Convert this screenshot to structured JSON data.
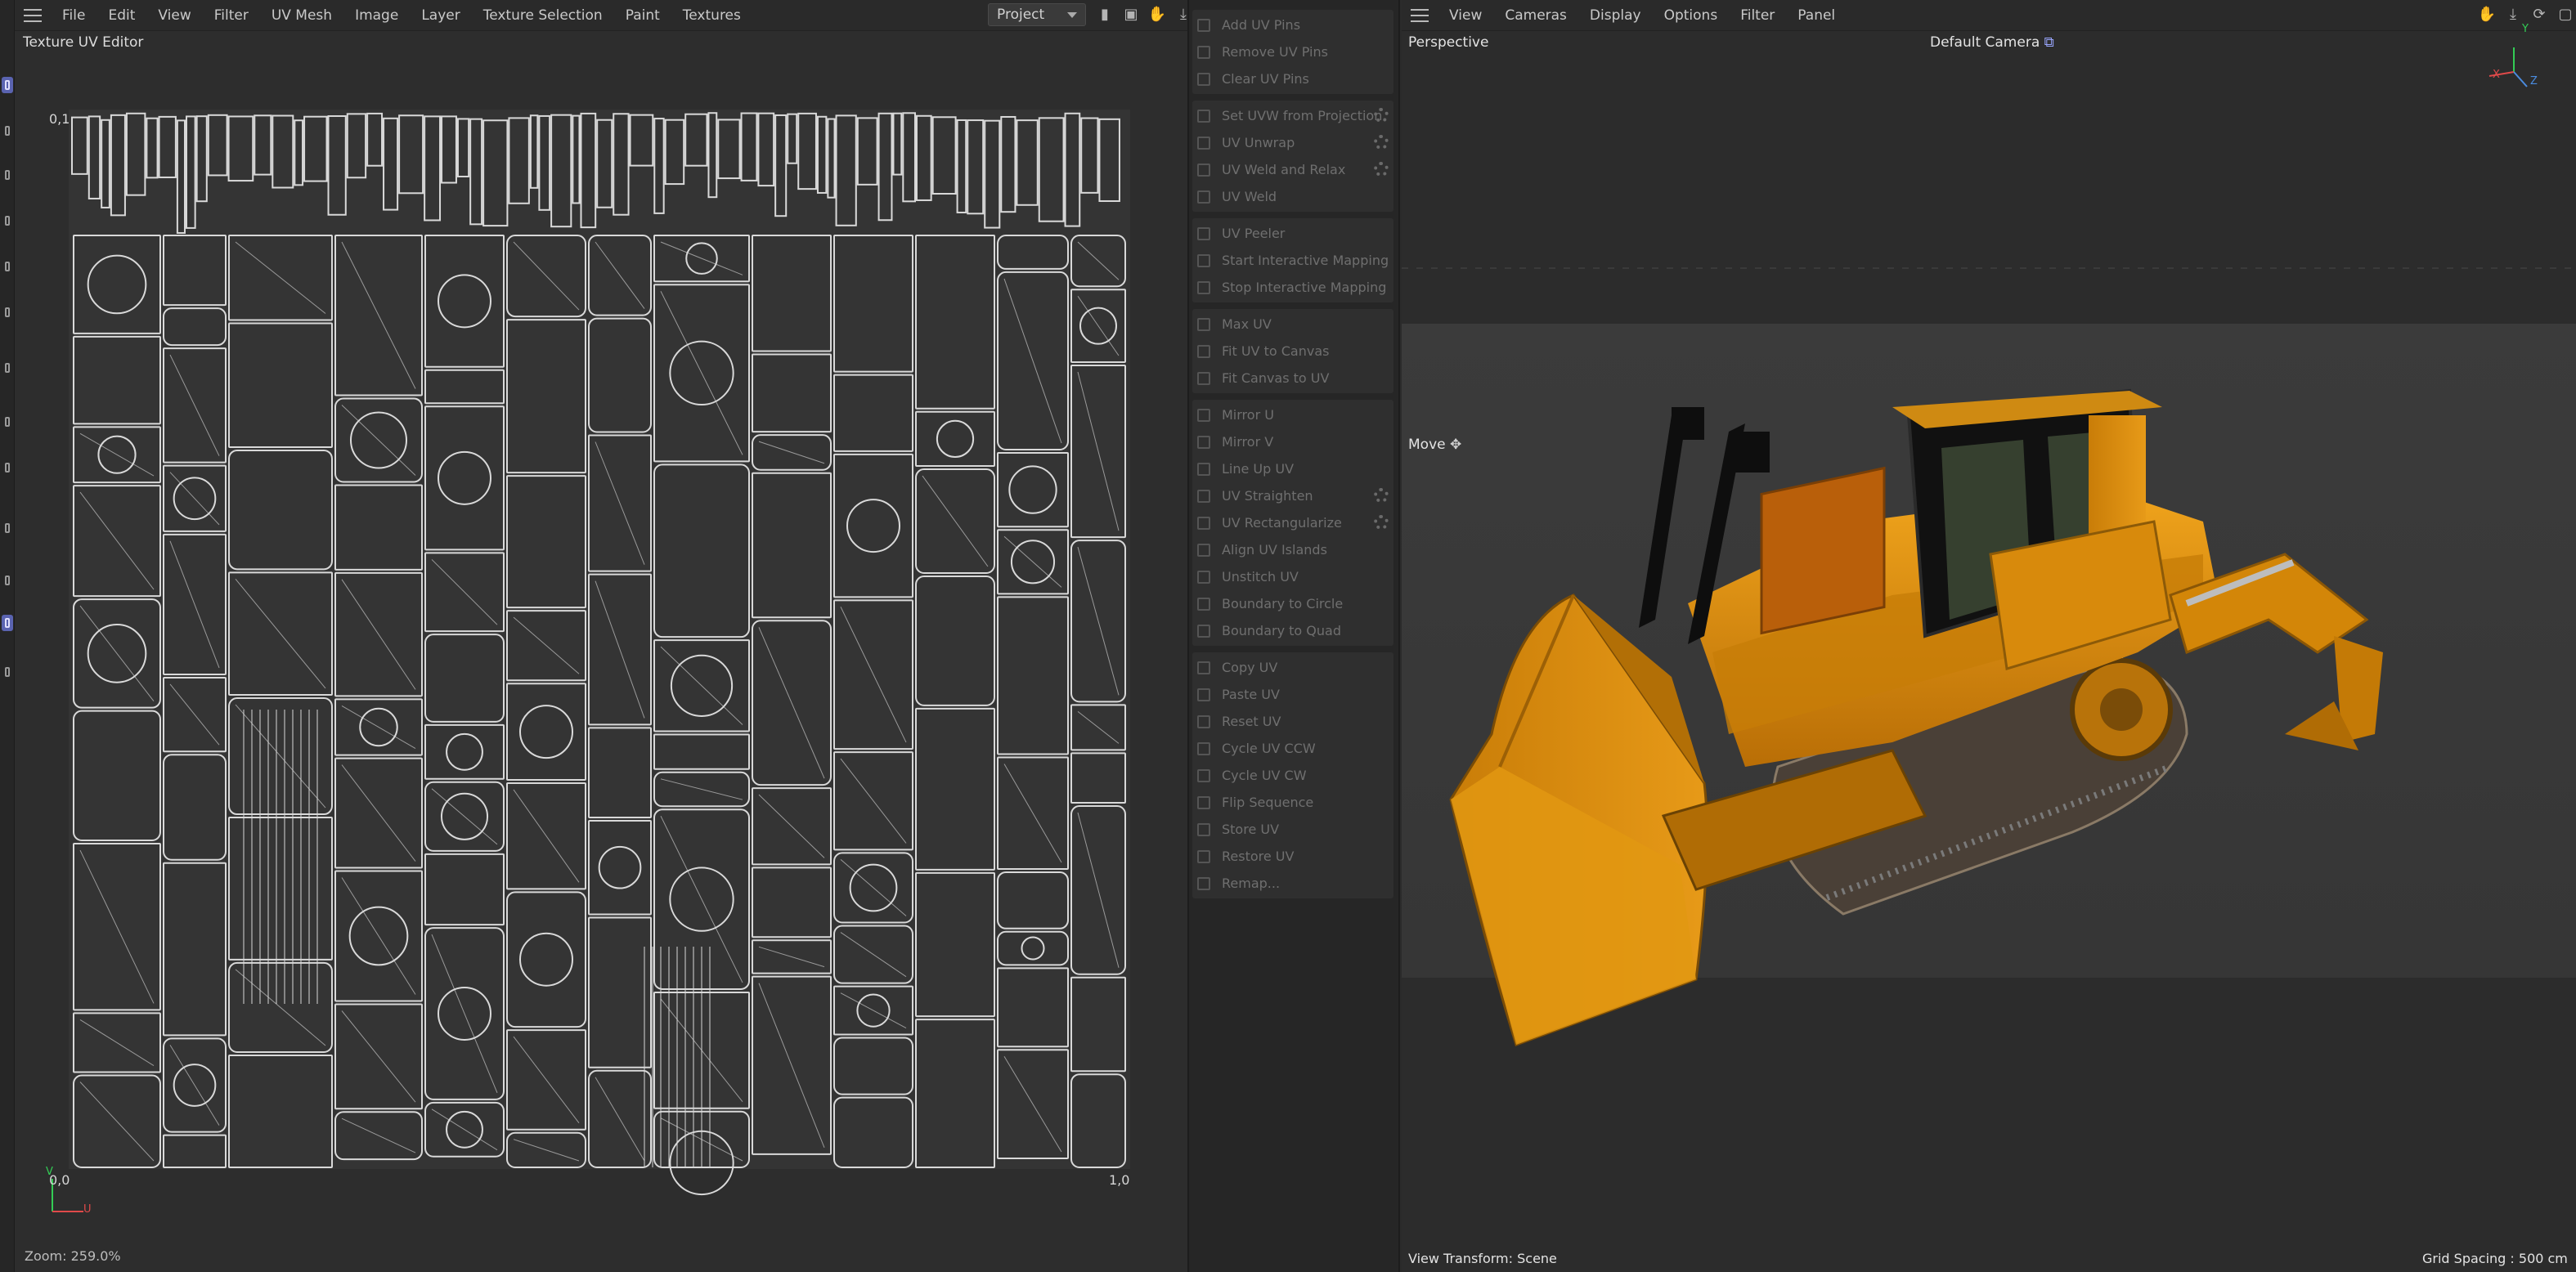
{
  "uv_editor": {
    "menu": [
      "File",
      "Edit",
      "View",
      "Filter",
      "UV Mesh",
      "Image",
      "Layer",
      "Texture Selection",
      "Paint",
      "Textures"
    ],
    "title": "Texture UV Editor",
    "project_select": "Project",
    "coord_top_left": "0,1",
    "coord_bottom_left": "0,0",
    "coord_bottom_right": "1,0",
    "axis_v": "V",
    "axis_u": "U",
    "zoom_status": "Zoom: 259.0%"
  },
  "commands": {
    "groups": [
      [
        {
          "label": "Add UV Pins",
          "gear": false
        },
        {
          "label": "Remove UV Pins",
          "gear": false
        },
        {
          "label": "Clear UV Pins",
          "gear": false
        }
      ],
      [
        {
          "label": "Set UVW from Projection",
          "gear": true
        },
        {
          "label": "UV Unwrap",
          "gear": true
        },
        {
          "label": "UV Weld and Relax",
          "gear": true
        },
        {
          "label": "UV Weld",
          "gear": false
        }
      ],
      [
        {
          "label": "UV Peeler",
          "gear": false
        },
        {
          "label": "Start Interactive Mapping",
          "gear": false
        },
        {
          "label": "Stop Interactive Mapping",
          "gear": false
        }
      ],
      [
        {
          "label": "Max UV",
          "gear": false
        },
        {
          "label": "Fit UV to Canvas",
          "gear": false
        },
        {
          "label": "Fit Canvas to UV",
          "gear": false
        }
      ],
      [
        {
          "label": "Mirror U",
          "gear": false
        },
        {
          "label": "Mirror V",
          "gear": false
        },
        {
          "label": "Line Up UV",
          "gear": false
        },
        {
          "label": "UV Straighten",
          "gear": true
        },
        {
          "label": "UV Rectangularize",
          "gear": true
        },
        {
          "label": "Align UV Islands",
          "gear": false
        },
        {
          "label": "Unstitch UV",
          "gear": false
        },
        {
          "label": "Boundary to Circle",
          "gear": false
        },
        {
          "label": "Boundary to Quad",
          "gear": false
        }
      ],
      [
        {
          "label": "Copy UV",
          "gear": false
        },
        {
          "label": "Paste UV",
          "gear": false
        },
        {
          "label": "Reset UV",
          "gear": false
        },
        {
          "label": "Cycle UV CCW",
          "gear": false
        },
        {
          "label": "Cycle UV CW",
          "gear": false
        },
        {
          "label": "Flip Sequence",
          "gear": false
        },
        {
          "label": "Store UV",
          "gear": false
        },
        {
          "label": "Restore UV",
          "gear": false
        },
        {
          "label": "Remap...",
          "gear": false
        }
      ]
    ]
  },
  "viewport": {
    "menu": [
      "View",
      "Cameras",
      "Display",
      "Options",
      "Filter",
      "Panel"
    ],
    "view_name": "Perspective",
    "camera": "Default Camera",
    "tool": "Move",
    "axis_labels": {
      "y": "Y",
      "x": "X",
      "z": "Z"
    },
    "view_transform": "View Transform: Scene",
    "grid_spacing": "Grid Spacing : 500 cm"
  },
  "colors": {
    "accent": "#5a63b0",
    "uv_wire": "#d9d9d9",
    "bulldozer_yellow": "#d88a0c"
  }
}
